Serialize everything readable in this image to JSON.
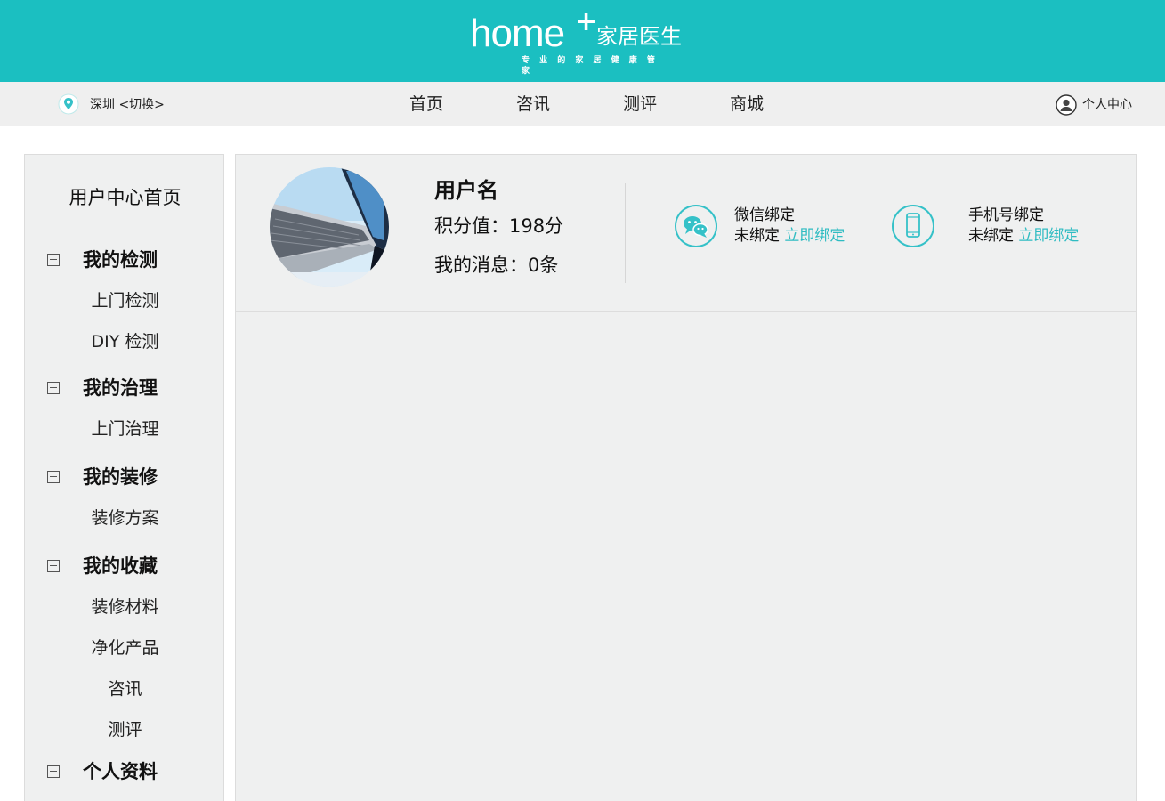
{
  "header": {
    "logo_home": "home",
    "logo_plus": "+",
    "logo_cn": "家居医生",
    "logo_slogan": "专 业 的 家 居 健 康 管 家"
  },
  "navbar": {
    "city": "深圳",
    "switch_label": "<切换>",
    "items": [
      "首页",
      "咨讯",
      "测评",
      "商城"
    ],
    "user_center": "个人中心"
  },
  "sidebar": {
    "home": "用户中心首页",
    "sections": [
      {
        "label": "我的检测",
        "items": [
          "上门检测",
          "DIY 检测"
        ]
      },
      {
        "label": "我的治理",
        "items": [
          "上门治理"
        ]
      },
      {
        "label": "我的装修",
        "items": [
          "装修方案"
        ]
      },
      {
        "label": "我的收藏",
        "items": [
          "装修材料",
          "净化产品",
          "咨讯",
          "测评"
        ]
      },
      {
        "label": "个人资料",
        "items": []
      }
    ]
  },
  "profile": {
    "username": "用户名",
    "points": "积分值：198分",
    "messages": "我的消息：0条",
    "bindings": [
      {
        "title": "微信绑定",
        "status": "未绑定",
        "action": "立即绑定",
        "icon": "wechat-icon"
      },
      {
        "title": "手机号绑定",
        "status": "未绑定",
        "action": "立即绑定",
        "icon": "phone-icon"
      }
    ]
  },
  "colors": {
    "brand": "#1bbfc1",
    "link": "#2fbcc2",
    "panel_bg": "#eff0f0"
  }
}
